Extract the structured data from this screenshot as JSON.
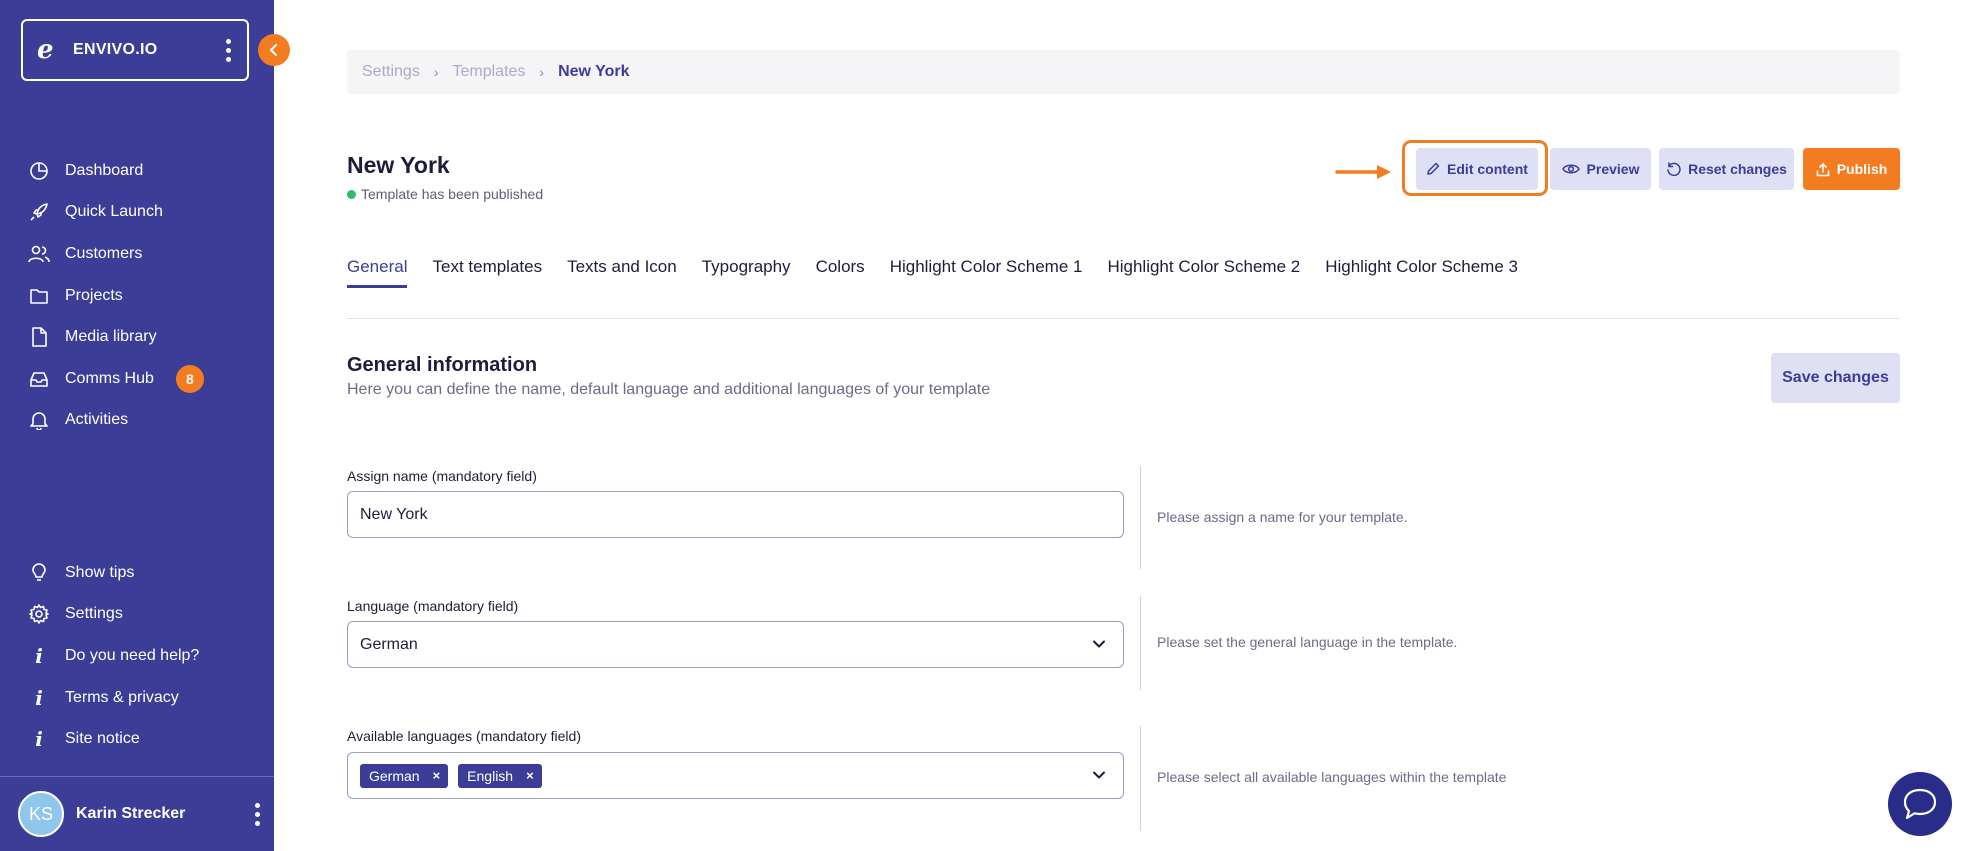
{
  "sidebar": {
    "org_logo": "e",
    "org_name": "ENVIVO.IO",
    "nav": [
      {
        "label": "Dashboard",
        "icon": "pie-chart-icon"
      },
      {
        "label": "Quick Launch",
        "icon": "rocket-icon"
      },
      {
        "label": "Customers",
        "icon": "users-icon"
      },
      {
        "label": "Projects",
        "icon": "folder-icon"
      },
      {
        "label": "Media library",
        "icon": "file-icon"
      },
      {
        "label": "Comms Hub",
        "icon": "inbox-icon",
        "badge": "8"
      },
      {
        "label": "Activities",
        "icon": "bell-icon"
      }
    ],
    "bottom_nav": [
      {
        "label": "Show tips",
        "icon": "lightbulb-icon"
      },
      {
        "label": "Settings",
        "icon": "gear-icon"
      },
      {
        "label": "Do you need help?",
        "icon": "info-icon"
      },
      {
        "label": "Terms & privacy",
        "icon": "info-icon"
      },
      {
        "label": "Site notice",
        "icon": "info-icon"
      }
    ],
    "user": {
      "initials": "KS",
      "name": "Karin Strecker"
    }
  },
  "breadcrumb": {
    "items": [
      "Settings",
      "Templates"
    ],
    "current": "New York"
  },
  "header": {
    "title": "New York",
    "status": "Template has been published",
    "status_color": "#2bbd6b",
    "buttons": {
      "edit": "Edit content",
      "preview": "Preview",
      "reset": "Reset changes",
      "publish": "Publish"
    }
  },
  "tabs": [
    "General",
    "Text templates",
    "Texts and Icon",
    "Typography",
    "Colors",
    "Highlight Color Scheme 1",
    "Highlight Color Scheme 2",
    "Highlight Color Scheme 3"
  ],
  "active_tab": "General",
  "section": {
    "title": "General information",
    "description": "Here you can define the name, default language and additional languages of your template",
    "save_label": "Save changes"
  },
  "form": {
    "name": {
      "label": "Assign name (mandatory field)",
      "value": "New York",
      "hint": "Please assign a name for your template."
    },
    "language": {
      "label": "Language (mandatory field)",
      "value": "German",
      "hint": "Please set the general language in the template."
    },
    "available_languages": {
      "label": "Available languages (mandatory field)",
      "tags": [
        "German",
        "English"
      ],
      "remove_symbol": "×",
      "hint": "Please select all available languages within the template"
    }
  },
  "colors": {
    "sidebar": "#3b3d97",
    "accent": "#f47c20",
    "secondary_button": "#dfe0f4"
  }
}
